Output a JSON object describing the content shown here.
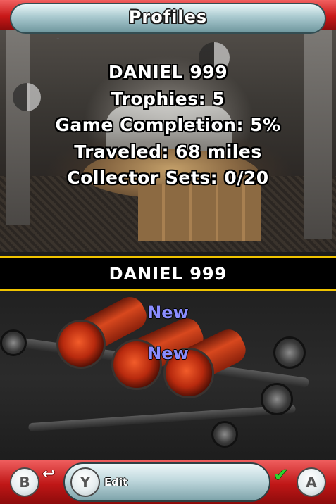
{
  "top_screen": {
    "title": "Profiles",
    "indicator": "...",
    "profile": {
      "name": "DANIEL 999",
      "trophies": "Trophies: 5",
      "completion": "Game Completion: 5%",
      "traveled": "Traveled: 68 miles",
      "collector_sets": "Collector Sets: 0/20"
    }
  },
  "bottom_screen": {
    "selected_profile": "DANIEL 999",
    "slots": [
      "New",
      "New"
    ],
    "controls": {
      "b_button": "B",
      "y_button": "Y",
      "y_label": "Edit",
      "a_button": "A"
    }
  },
  "colors": {
    "accent_red": "#c81818",
    "header_yellow": "#f0c400",
    "slot_text": "#8a8dff",
    "confirm_green": "#2fd52f"
  },
  "icons": [
    "back-arrow-icon",
    "checkmark-icon",
    "yin-yang-icon"
  ]
}
